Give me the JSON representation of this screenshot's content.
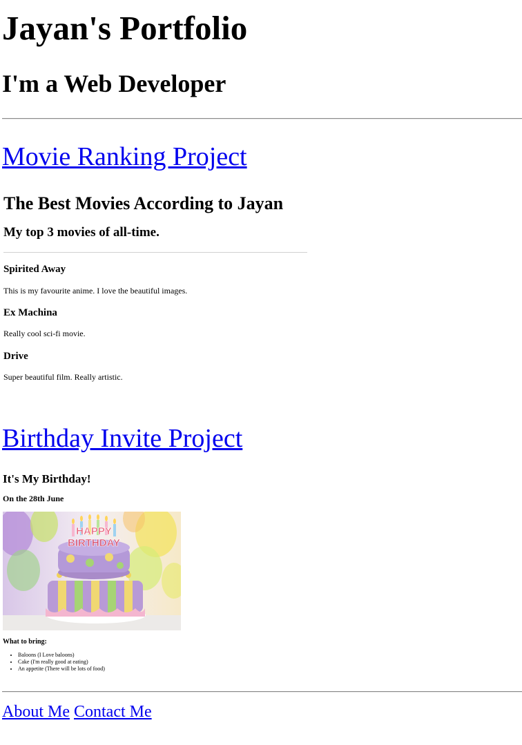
{
  "header": {
    "title": "Jayan's Portfolio",
    "subtitle": "I'm a Web Developer"
  },
  "movie_project": {
    "link_text": "Movie Ranking Project",
    "heading": "The Best Movies According to Jayan",
    "subheading": "My top 3 movies of all-time.",
    "movies": [
      {
        "name": "Spirited Away",
        "description": "This is my favourite anime. I love the beautiful images."
      },
      {
        "name": "Ex Machina",
        "description": "Really cool sci-fi movie."
      },
      {
        "name": "Drive",
        "description": "Super beautiful film. Really artistic."
      }
    ]
  },
  "birthday_project": {
    "link_text": "Birthday Invite Project",
    "heading": "It's My Birthday!",
    "date": "On the 28th June",
    "cake_text_line1": "HAPPY",
    "cake_text_line2": "BIRTHDAY",
    "bring_label": "What to bring:",
    "bring_items": [
      "Baloons (I Love baloons)",
      "Cake (I'm really good at eating)",
      "An appetite (There will be lots of food)"
    ]
  },
  "footer": {
    "about_label": "About Me",
    "contact_label": "Contact Me"
  },
  "colors": {
    "link": "#0000ee",
    "text": "#000000",
    "background": "#ffffff"
  }
}
